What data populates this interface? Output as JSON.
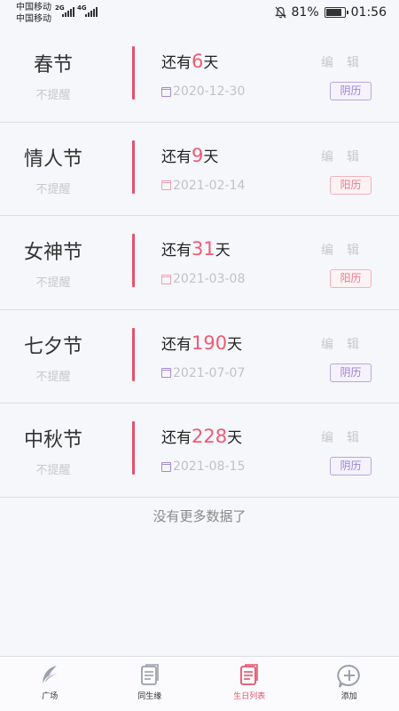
{
  "status_bar": {
    "carrier1": "中国移动",
    "carrier2": "中国移动",
    "net1": "2G",
    "net2": "4G",
    "battery_text": "81%",
    "battery_level": 0.81,
    "time": "01:56"
  },
  "festivals": [
    {
      "name": "春节",
      "remind": "不提醒",
      "prefix": "还有",
      "days": "6",
      "suffix": "天",
      "date": "2020-12-30",
      "calendar": "阴历",
      "edit": "编辑"
    },
    {
      "name": "情人节",
      "remind": "不提醒",
      "prefix": "还有",
      "days": "9",
      "suffix": "天",
      "date": "2021-02-14",
      "calendar": "阳历",
      "edit": "编辑"
    },
    {
      "name": "女神节",
      "remind": "不提醒",
      "prefix": "还有",
      "days": "31",
      "suffix": "天",
      "date": "2021-03-08",
      "calendar": "阳历",
      "edit": "编辑"
    },
    {
      "name": "七夕节",
      "remind": "不提醒",
      "prefix": "还有",
      "days": "190",
      "suffix": "天",
      "date": "2021-07-07",
      "calendar": "阴历",
      "edit": "编辑"
    },
    {
      "name": "中秋节",
      "remind": "不提醒",
      "prefix": "还有",
      "days": "228",
      "suffix": "天",
      "date": "2021-08-15",
      "calendar": "阴历",
      "edit": "编辑"
    }
  ],
  "no_more_text": "没有更多数据了",
  "tabs": [
    {
      "label": "广场",
      "icon": "plaza-icon"
    },
    {
      "label": "同生缘",
      "icon": "document-icon"
    },
    {
      "label": "生日列表",
      "icon": "birthday-list-icon"
    },
    {
      "label": "添加",
      "icon": "add-icon"
    }
  ],
  "colors": {
    "accent": "#e8506d",
    "lunar": "#9b82d4",
    "solar": "#f0768c"
  }
}
